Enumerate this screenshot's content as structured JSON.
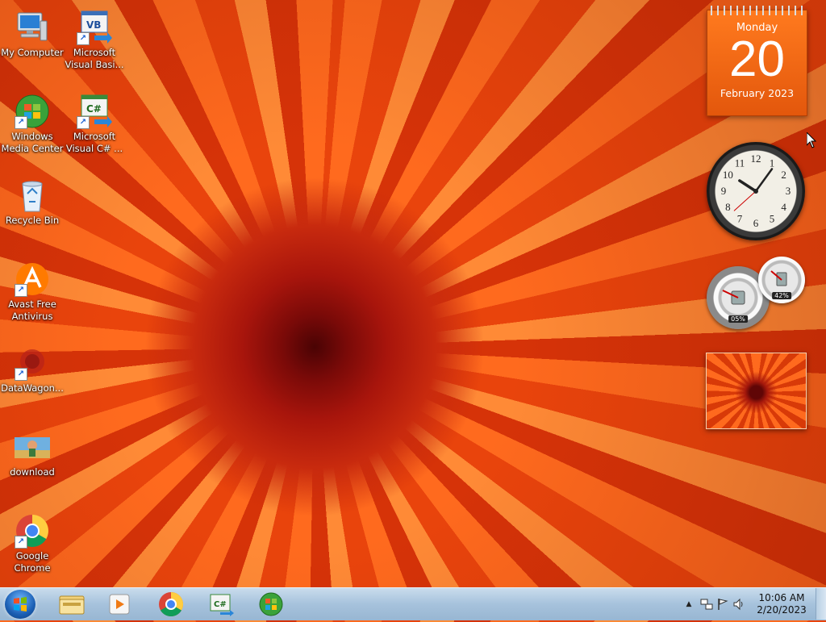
{
  "desktop": {
    "icons": [
      {
        "label": "My Computer"
      },
      {
        "label": "Microsoft Visual Basi..."
      },
      {
        "label": "Windows Media Center"
      },
      {
        "label": "Microsoft Visual C# ..."
      },
      {
        "label": "Recycle Bin"
      },
      {
        "label": "Avast Free Antivirus"
      },
      {
        "label": "DataWagon..."
      },
      {
        "label": "download"
      },
      {
        "label": "Google Chrome"
      }
    ]
  },
  "gadgets": {
    "calendar": {
      "weekday": "Monday",
      "day": "20",
      "month_year": "February 2023"
    },
    "clock": {
      "numerals": [
        "12",
        "1",
        "2",
        "3",
        "4",
        "5",
        "6",
        "7",
        "8",
        "9",
        "10",
        "11"
      ],
      "hour": 10,
      "minute": 6
    },
    "cpu_meter": {
      "cpu": "05%",
      "ram": "42%"
    }
  },
  "taskbar": {
    "pinned": [
      "windows-explorer",
      "media-player",
      "google-chrome",
      "visual-csharp",
      "windows-media-center"
    ],
    "tray": {
      "time": "10:06 AM",
      "date": "2/20/2023",
      "expand": "▲"
    }
  },
  "colors": {
    "accent": "#e3570c",
    "taskbar": "#a6c2dc"
  }
}
